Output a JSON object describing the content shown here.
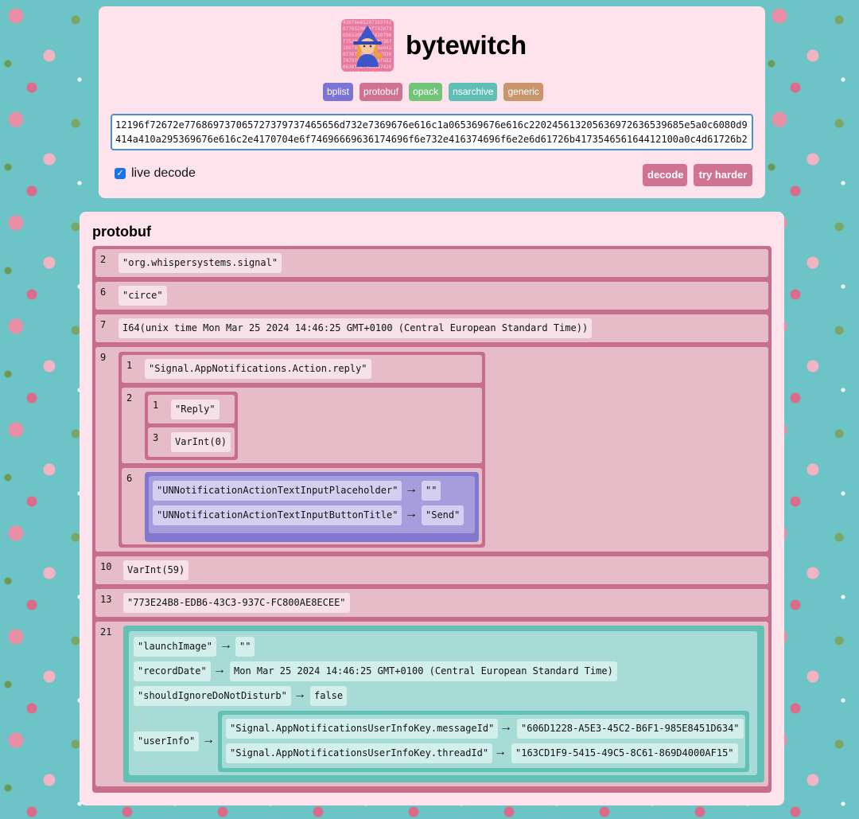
{
  "app": {
    "title": "bytewitch",
    "logo_hex": "436f6e6520736974207765206e6f74207365652062757420796f752061726520736f206f6e6520616e6420736f206d616e79207479706573206f6620636f6e74656e74206e65656420746f206265206465636f646564"
  },
  "tabs": [
    {
      "label": "bplist",
      "color": "#7c74d3"
    },
    {
      "label": "protobuf",
      "color": "#d07292"
    },
    {
      "label": "opack",
      "color": "#72c47a"
    },
    {
      "label": "nsarchive",
      "color": "#5fbfb6"
    },
    {
      "label": "generic",
      "color": "#c8956c"
    }
  ],
  "input": {
    "value": "12196f72672e776869737065727379737465656d732e7369676e616c1a065369676e616c220245613205636972636539685e5a0c6080d9414a410a295369676e616c2e4170704e6f74696669636174696f6e732e416374696f6e2e6d61726b417354656164412100a0c4d61726b2061"
  },
  "live_decode": {
    "label": "live decode",
    "checked": true
  },
  "buttons": {
    "decode": "decode",
    "try_harder": "try harder"
  },
  "result": {
    "title": "protobuf",
    "rows": {
      "f2": {
        "num": "2",
        "value": "\"org.whispersystems.signal\""
      },
      "f6": {
        "num": "6",
        "value": "\"circe\""
      },
      "f7": {
        "num": "7",
        "value": "I64(unix time Mon Mar 25 2024 14:46:25 GMT+0100 (Central European Standard Time))"
      },
      "f9": {
        "num": "9",
        "sub1": {
          "num": "1",
          "value": "\"Signal.AppNotifications.Action.reply\""
        },
        "sub2": {
          "num": "2",
          "a": {
            "num": "1",
            "value": "\"Reply\""
          },
          "b": {
            "num": "3",
            "value": "VarInt(0)"
          }
        },
        "sub6": {
          "num": "6",
          "entries": [
            {
              "key": "\"UNNotificationActionTextInputPlaceholder\"",
              "value": "\"\""
            },
            {
              "key": "\"UNNotificationActionTextInputButtonTitle\"",
              "value": "\"Send\""
            }
          ]
        }
      },
      "f10": {
        "num": "10",
        "value": "VarInt(59)"
      },
      "f13": {
        "num": "13",
        "value": "\"773E24B8-EDB6-43C3-937C-FC800AE8ECEE\""
      },
      "f21": {
        "num": "21",
        "entries": [
          {
            "key": "\"launchImage\"",
            "value": "\"\""
          },
          {
            "key": "\"recordDate\"",
            "value": "Mon Mar 25 2024 14:46:25 GMT+0100 (Central European Standard Time)"
          },
          {
            "key": "\"shouldIgnoreDoNotDisturb\"",
            "value": "false"
          }
        ],
        "userinfo": {
          "key": "\"userInfo\"",
          "entries": [
            {
              "key": "\"Signal.AppNotificationsUserInfoKey.messageId\"",
              "value": "\"606D1228-A5E3-45C2-B6F1-985E8451D634\""
            },
            {
              "key": "\"Signal.AppNotificationsUserInfoKey.threadId\"",
              "value": "\"163CD1F9-5415-49C5-8C61-869D4000AF15\""
            }
          ]
        }
      }
    }
  },
  "arrow": "→"
}
